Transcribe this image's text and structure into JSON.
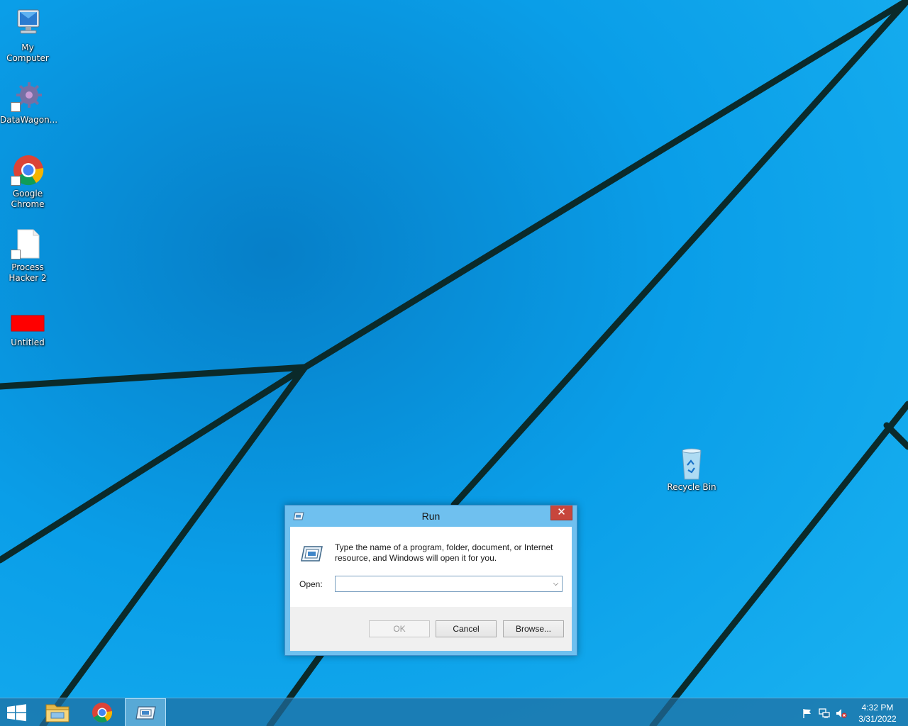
{
  "desktop": {
    "icons": [
      {
        "label_line1": "My",
        "label_line2": "Computer",
        "icon": "computer-icon"
      },
      {
        "label_line1": "DataWagon...",
        "label_line2": "",
        "icon": "gear-icon"
      },
      {
        "label_line1": "Google",
        "label_line2": "Chrome",
        "icon": "chrome-icon"
      },
      {
        "label_line1": "Process",
        "label_line2": "Hacker 2",
        "icon": "document-icon"
      },
      {
        "label_line1": "Untitled",
        "label_line2": "",
        "icon": "red-image-icon"
      },
      {
        "label_line1": "Recycle Bin",
        "label_line2": "",
        "icon": "recycle-bin-icon"
      }
    ]
  },
  "run_dialog": {
    "title": "Run",
    "close_symbol": "✕",
    "description_line1": "Type the name of a program, folder, document, or Internet",
    "description_line2": "resource, and Windows will open it for you.",
    "open_label": "Open:",
    "open_value": "",
    "buttons": {
      "ok": "OK",
      "cancel": "Cancel",
      "browse": "Browse..."
    }
  },
  "taskbar": {
    "items": [
      "start-icon",
      "file-explorer-icon",
      "chrome-icon",
      "run-icon"
    ],
    "active_item": "run-icon"
  },
  "tray": {
    "icons": [
      "flag-icon",
      "network-icon",
      "volume-muted-icon"
    ],
    "time": "4:32 PM",
    "date": "3/31/2022"
  },
  "colors": {
    "wallpaper": "#0a9ee8",
    "wallpaper_lines": "#0b2a2a",
    "dialog_frame": "#6fc0ef",
    "close_button": "#c7463c"
  }
}
